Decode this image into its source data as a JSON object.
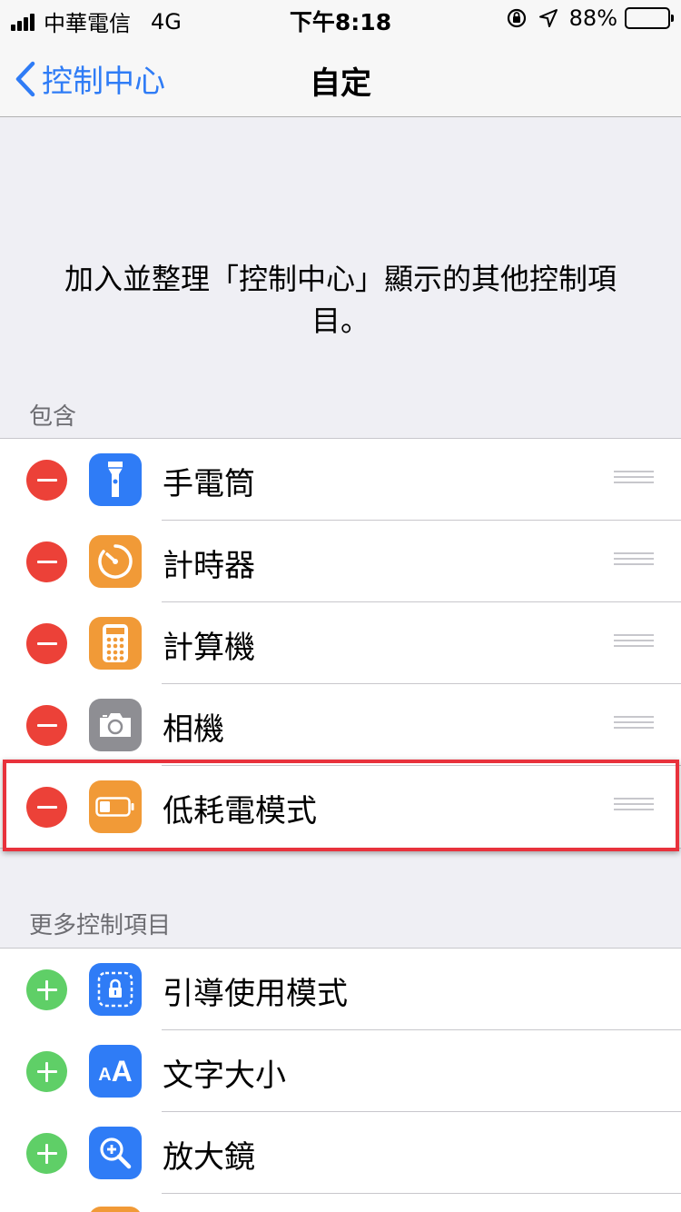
{
  "status_bar": {
    "carrier": "中華電信",
    "network": "4G",
    "time": "下午8:18",
    "battery": "88%",
    "battery_level": 0.88
  },
  "nav": {
    "back_label": "控制中心",
    "title": "自定"
  },
  "intro_text": "加入並整理「控制中心」顯示的其他控制項目。",
  "included": {
    "header": "包含",
    "items": [
      {
        "label": "手電筒",
        "icon": "flashlight-icon",
        "color": "#2f7cf6"
      },
      {
        "label": "計時器",
        "icon": "timer-icon",
        "color": "#f19a37"
      },
      {
        "label": "計算機",
        "icon": "calculator-icon",
        "color": "#f19a37"
      },
      {
        "label": "相機",
        "icon": "camera-icon",
        "color": "#8e8e93"
      },
      {
        "label": "低耗電模式",
        "icon": "battery-icon",
        "color": "#f19a37"
      }
    ]
  },
  "more": {
    "header": "更多控制項目",
    "items": [
      {
        "label": "引導使用模式",
        "icon": "lock-icon",
        "color": "#2f7cf6"
      },
      {
        "label": "文字大小",
        "icon": "text-size-icon",
        "color": "#2f7cf6",
        "glyph_small": "A",
        "glyph_large": "A"
      },
      {
        "label": "放大鏡",
        "icon": "magnifier-icon",
        "color": "#2f7cf6"
      }
    ]
  },
  "colors": {
    "accent": "#2f7cf6",
    "remove": "#ec4138",
    "add": "#5fcf67",
    "highlight": "#e8323c"
  }
}
